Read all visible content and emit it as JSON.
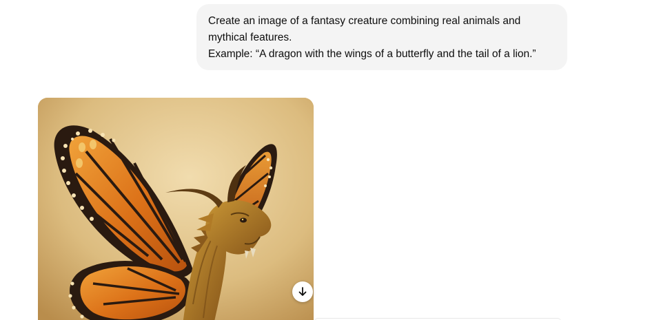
{
  "conversation": {
    "user_message": {
      "line1": "Create an image of a fantasy creature combining real animals and",
      "line2": "mythical features.",
      "line3": "Example: “A dragon with the wings of a butterfly and the tail of a lion.”"
    },
    "assistant_image": {
      "download_icon": "arrow-down-icon"
    }
  },
  "colors": {
    "bubble_background": "#f4f4f4",
    "text": "#0d0d0d",
    "wing_orange": "#d9731c",
    "wing_black": "#2a1a10",
    "parchment": "#e3c78f",
    "dragon_scale": "#a8761f"
  }
}
